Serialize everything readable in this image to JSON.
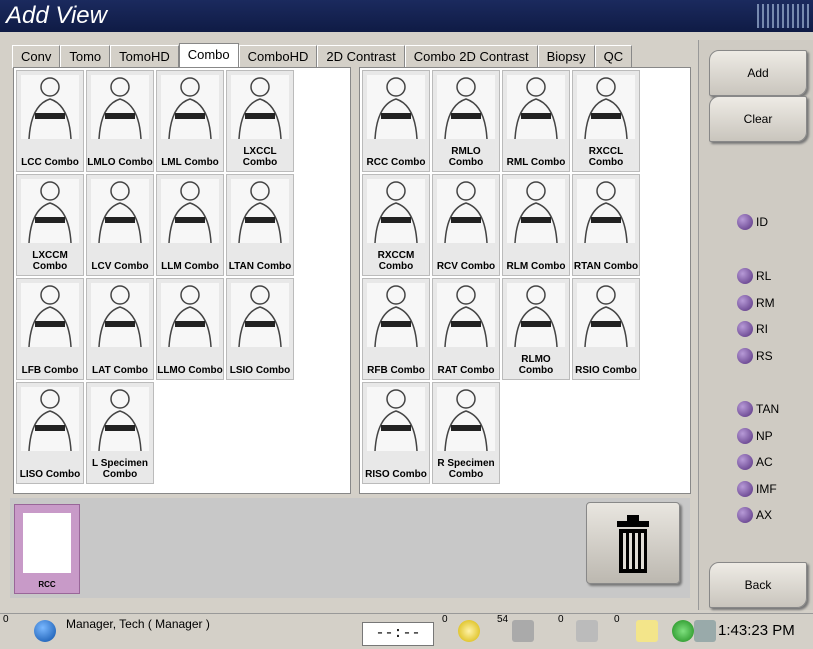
{
  "window": {
    "title": "Add View"
  },
  "tabs": [
    "Conv",
    "Tomo",
    "TomoHD",
    "Combo",
    "ComboHD",
    "2D Contrast",
    "Combo 2D Contrast",
    "Biopsy",
    "QC"
  ],
  "active_tab": "Combo",
  "left_views": [
    "LCC Combo",
    "LMLO Combo",
    "LML Combo",
    "LXCCL Combo",
    "LXCCM Combo",
    "LCV Combo",
    "LLM Combo",
    "LTAN Combo",
    "LFB Combo",
    "LAT Combo",
    "LLMO Combo",
    "LSIO Combo",
    "LISO Combo",
    "L Specimen Combo"
  ],
  "right_views": [
    "RCC Combo",
    "RMLO Combo",
    "RML Combo",
    "RXCCL Combo",
    "RXCCM Combo",
    "RCV Combo",
    "RLM Combo",
    "RTAN Combo",
    "RFB Combo",
    "RAT Combo",
    "RLMO Combo",
    "RSIO Combo",
    "RISO Combo",
    "R Specimen Combo"
  ],
  "selected": {
    "label": "RCC"
  },
  "buttons": {
    "add": "Add",
    "clear": "Clear",
    "back": "Back"
  },
  "modifiers": {
    "group1": [
      "ID"
    ],
    "group2": [
      "RL",
      "RM",
      "RI",
      "RS"
    ],
    "group3": [
      "TAN",
      "NP",
      "AC",
      "IMF",
      "AX"
    ]
  },
  "status": {
    "info_count": "0",
    "user": "Manager, Tech ( Manager )",
    "timer": "--:--",
    "count_a": "0",
    "count_b": "54",
    "count_c": "0",
    "count_d": "0",
    "time": "1:43:23 PM"
  }
}
